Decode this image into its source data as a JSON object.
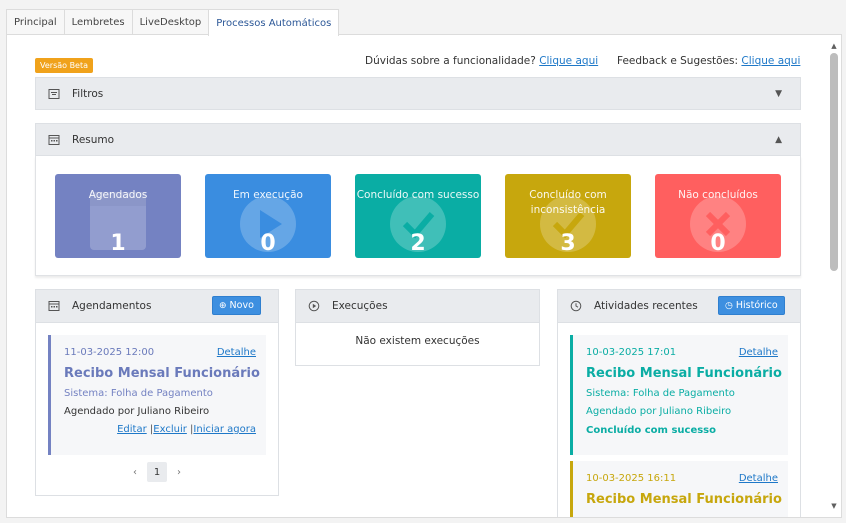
{
  "tabs": [
    "Principal",
    "Lembretes",
    "LiveDesktop",
    "Processos Automáticos"
  ],
  "beta_label": "Versão Beta",
  "help": {
    "doubts_text": "Dúvidas sobre a funcionalidade?",
    "doubts_link": "Clique aqui",
    "feedback_text": "Feedback e Sugestões:",
    "feedback_link": "Clique aqui"
  },
  "filters": {
    "title": "Filtros",
    "icon": "filter-icon"
  },
  "summary": {
    "title": "Resumo",
    "icon": "calendar-icon",
    "cards": [
      {
        "label": "Agendados",
        "value": "1",
        "color": "#7482c2",
        "icon": "calendar-icon"
      },
      {
        "label": "Em execução",
        "value": "0",
        "color": "#3a8de0",
        "icon": "play-icon"
      },
      {
        "label": "Concluído com sucesso",
        "value": "2",
        "color": "#0aada4",
        "icon": "check-icon"
      },
      {
        "label": "Concluído com inconsistência",
        "value": "3",
        "color": "#c7a70d",
        "icon": "check-icon"
      },
      {
        "label": "Não concluídos",
        "value": "0",
        "color": "#ff5f5f",
        "icon": "x-icon"
      }
    ]
  },
  "schedules": {
    "title": "Agendamentos",
    "button": "Novo",
    "item": {
      "date": "11-03-2025 12:00",
      "detail": "Detalhe",
      "title": "Recibo Mensal Funcionário",
      "system": "Sistema: Folha de Pagamento",
      "scheduled_by": "Agendado por Juliano Ribeiro",
      "actions": [
        "Editar",
        "Excluir",
        "Iniciar agora"
      ]
    },
    "page": "1"
  },
  "executions": {
    "title": "Execuções",
    "empty": "Não existem execuções"
  },
  "recent": {
    "title": "Atividades recentes",
    "button": "Histórico",
    "items": [
      {
        "date": "10-03-2025 17:01",
        "detail": "Detalhe",
        "title": "Recibo Mensal Funcionário",
        "system": "Sistema: Folha de Pagamento",
        "by": "Agendado por Juliano Ribeiro",
        "status": "Concluído com sucesso"
      },
      {
        "date": "10-03-2025 16:11",
        "detail": "Detalhe",
        "title": "Recibo Mensal Funcionário"
      }
    ]
  }
}
